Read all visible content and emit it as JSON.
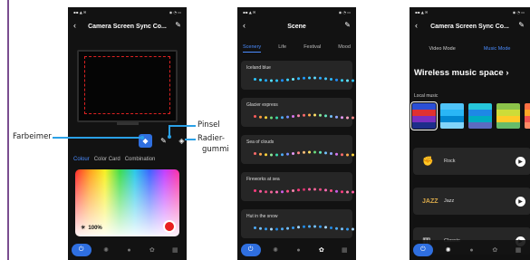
{
  "callouts": {
    "bucket": "Farbeimer",
    "brush": "Pinsel",
    "eraser_line1": "Radier-",
    "eraser_line2": "gummi"
  },
  "phone1": {
    "title": "Camera Screen Sync Co...",
    "tabs": [
      "Colour",
      "Color Card",
      "Combination"
    ],
    "brightness": "100%",
    "picker_color": "#e82020",
    "accent": "#2f6fe0"
  },
  "phone2": {
    "title": "Scene",
    "tabs": [
      "Scenery",
      "Life",
      "Festival",
      "Mood"
    ],
    "scenes": [
      {
        "name": "Iceland blue"
      },
      {
        "name": "Glacier express"
      },
      {
        "name": "Sea of clouds"
      },
      {
        "name": "Fireworks at sea"
      },
      {
        "name": "Hut in the snow"
      }
    ]
  },
  "phone3": {
    "title": "Camera Screen Sync Co...",
    "modes": [
      "Video Mode",
      "Music Mode"
    ],
    "space_title": "Wireless music space",
    "local_music": "Local music",
    "tracks": [
      {
        "name": "Rock",
        "icon": "rock-hand-icon"
      },
      {
        "name": "Jazz",
        "icon": "jazz-icon"
      },
      {
        "name": "Classic",
        "icon": "piano-icon"
      }
    ]
  }
}
